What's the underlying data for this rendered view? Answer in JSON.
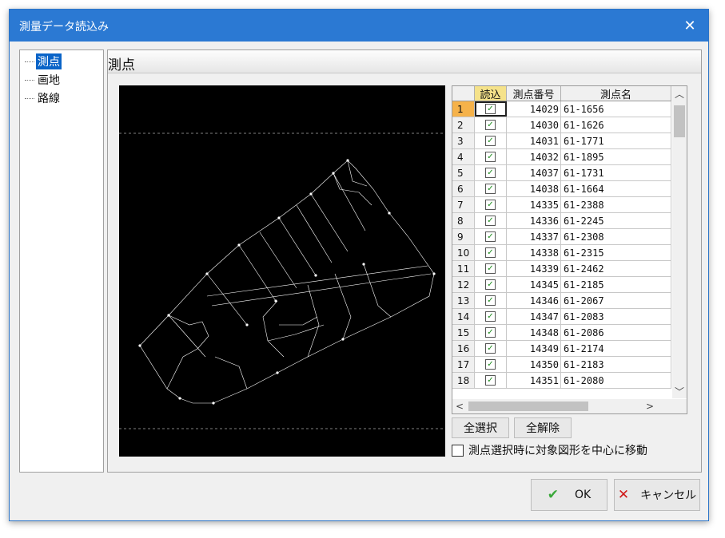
{
  "window": {
    "title": "測量データ読込み",
    "close_glyph": "✕"
  },
  "tree": {
    "items": [
      {
        "label": "測点",
        "selected": true
      },
      {
        "label": "画地",
        "selected": false
      },
      {
        "label": "路線",
        "selected": false
      }
    ]
  },
  "panel": {
    "title": "測点"
  },
  "grid": {
    "headers": {
      "rownum": "",
      "check": "読込",
      "number": "測点番号",
      "name": "測点名"
    },
    "rows": [
      {
        "row": "1",
        "checked": true,
        "number": "14029",
        "name": "61-1656"
      },
      {
        "row": "2",
        "checked": true,
        "number": "14030",
        "name": "61-1626"
      },
      {
        "row": "3",
        "checked": true,
        "number": "14031",
        "name": "61-1771"
      },
      {
        "row": "4",
        "checked": true,
        "number": "14032",
        "name": "61-1895"
      },
      {
        "row": "5",
        "checked": true,
        "number": "14037",
        "name": "61-1731"
      },
      {
        "row": "6",
        "checked": true,
        "number": "14038",
        "name": "61-1664"
      },
      {
        "row": "7",
        "checked": true,
        "number": "14335",
        "name": "61-2388"
      },
      {
        "row": "8",
        "checked": true,
        "number": "14336",
        "name": "61-2245"
      },
      {
        "row": "9",
        "checked": true,
        "number": "14337",
        "name": "61-2308"
      },
      {
        "row": "10",
        "checked": true,
        "number": "14338",
        "name": "61-2315"
      },
      {
        "row": "11",
        "checked": true,
        "number": "14339",
        "name": "61-2462"
      },
      {
        "row": "12",
        "checked": true,
        "number": "14345",
        "name": "61-2185"
      },
      {
        "row": "13",
        "checked": true,
        "number": "14346",
        "name": "61-2067"
      },
      {
        "row": "14",
        "checked": true,
        "number": "14347",
        "name": "61-2083"
      },
      {
        "row": "15",
        "checked": true,
        "number": "14348",
        "name": "61-2086"
      },
      {
        "row": "16",
        "checked": true,
        "number": "14349",
        "name": "61-2174"
      },
      {
        "row": "17",
        "checked": true,
        "number": "14350",
        "name": "61-2183"
      },
      {
        "row": "18",
        "checked": true,
        "number": "14351",
        "name": "61-2080"
      }
    ],
    "check_glyph": "✓",
    "scroll_up": "︿",
    "scroll_down": "﹀",
    "scroll_left": "<",
    "scroll_right": ">"
  },
  "buttons": {
    "select_all": "全選択",
    "deselect_all": "全解除",
    "ok": "OK",
    "ok_icon": "check-icon",
    "cancel": "キャンセル",
    "cancel_icon": "cross-icon"
  },
  "options": {
    "center_on_select": "測点選択時に対象図形を中心に移動",
    "center_on_select_checked": false
  },
  "colors": {
    "titlebar": "#2b79d3",
    "tree_selection": "#0a64c8",
    "active_row_header": "#f5b24a",
    "check_header": "#f5e28a",
    "canvas_background": "#000000",
    "ok_icon": "#3aa83a",
    "cancel_icon": "#d01818"
  }
}
